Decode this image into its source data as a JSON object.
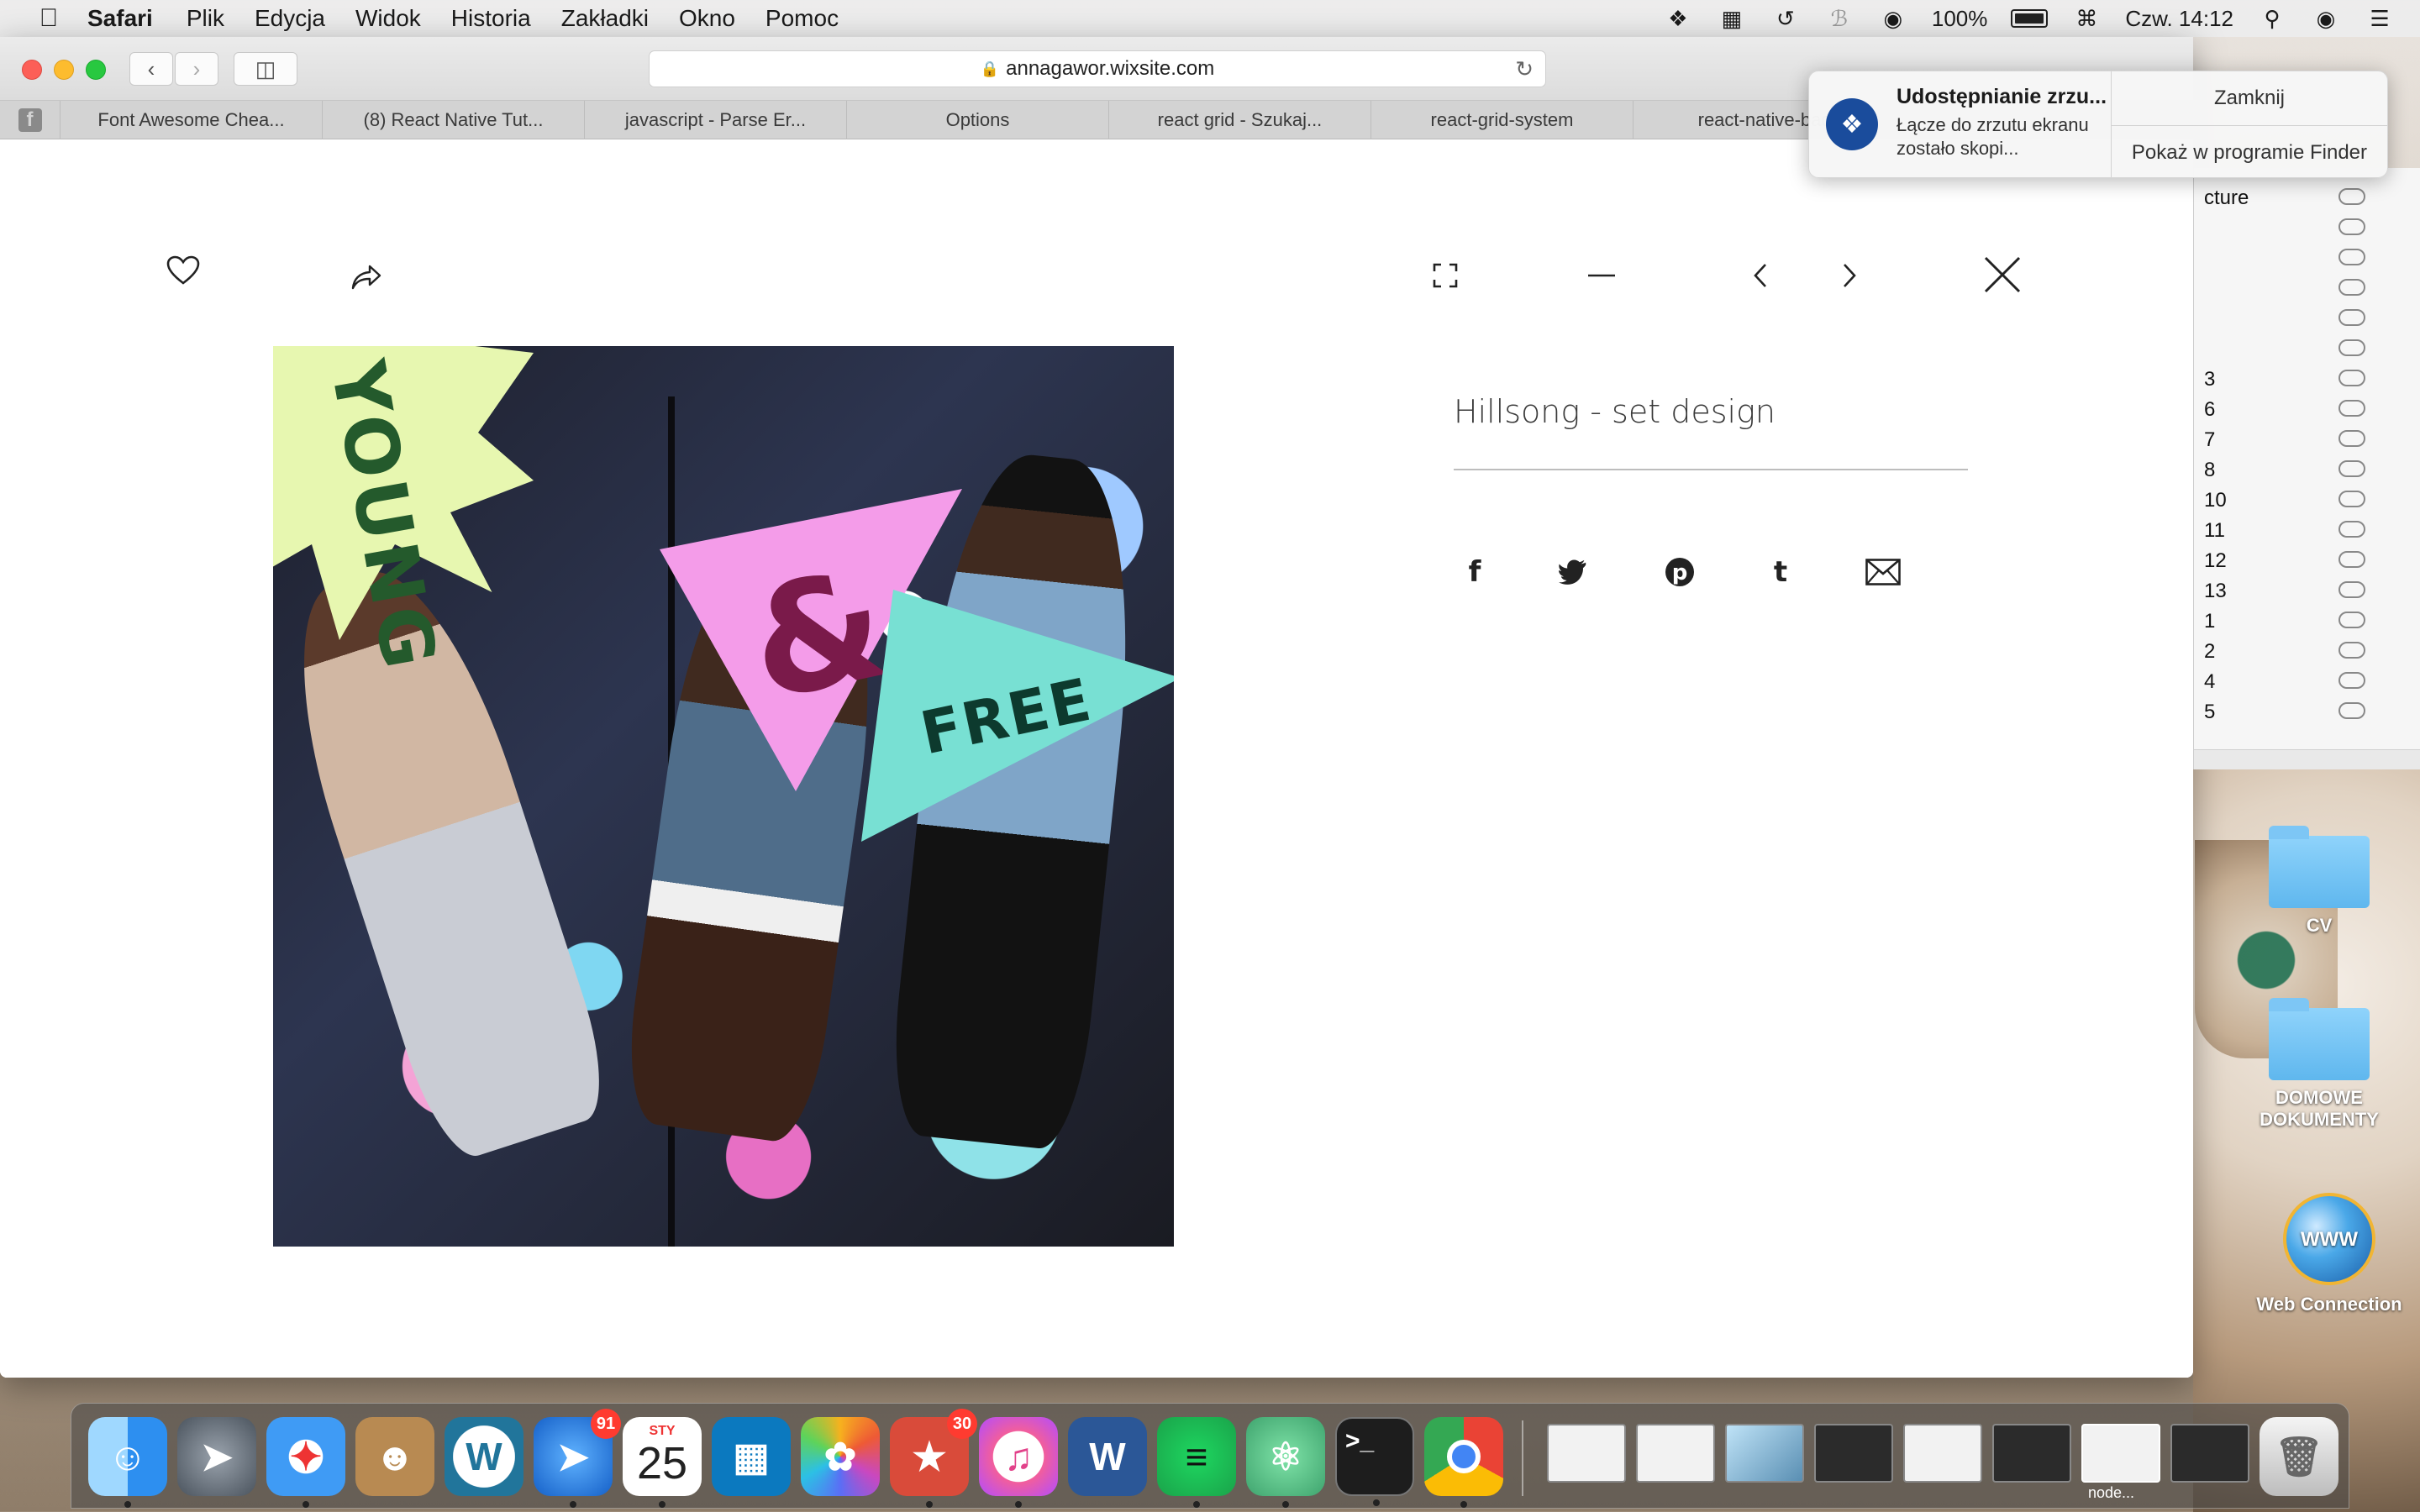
{
  "menubar": {
    "apple_icon": "apple-icon",
    "app_name": "Safari",
    "menus": [
      "Plik",
      "Edycja",
      "Widok",
      "Historia",
      "Zakładki",
      "Okno",
      "Pomoc"
    ],
    "battery": "100%",
    "clock": "Czw. 14:12",
    "status_icons": [
      "dropbox-icon",
      "evernote-icon",
      "time-machine-icon",
      "bluetooth-icon",
      "wifi-icon",
      "battery-icon",
      "keyboard-icon",
      "search-icon",
      "siri-icon",
      "notification-center-icon"
    ]
  },
  "browser": {
    "url": "annagawor.wixsite.com",
    "tabs": [
      "Font Awesome Chea...",
      "(8) React Native Tut...",
      "javascript - Parse Er...",
      "Options",
      "react grid - Szukaj...",
      "react-grid-system",
      "react-native-bac"
    ]
  },
  "lightbox": {
    "title": "Hillsong - set design",
    "photo_texts": {
      "young": "YOUNG",
      "amp": "&",
      "free": "FREE"
    },
    "top_icons": [
      "heart-icon",
      "share-arrow-icon",
      "fullscreen-icon",
      "minimize-icon",
      "prev-icon",
      "next-icon",
      "close-icon"
    ],
    "share_icons": [
      "facebook-icon",
      "twitter-icon",
      "pinterest-icon",
      "tumblr-icon",
      "email-icon"
    ],
    "share_glyphs": {
      "facebook": "f",
      "tumblr": "t"
    }
  },
  "notification": {
    "title": "Udostępnianie zrzu...",
    "text": "Łącze do zrzutu ekranu zostało skopi...",
    "close_label": "Zamknij",
    "finder_label": "Pokaż w programie Finder"
  },
  "finder": {
    "rows": [
      "cture",
      "",
      "",
      "",
      "",
      "",
      "3",
      "6",
      "7",
      "8",
      "10",
      "11",
      "12",
      "13",
      "1",
      "2",
      "4",
      "5"
    ]
  },
  "desktop": {
    "items": [
      "CV",
      "DOMOWE DOKUMENTY",
      "Web Connection"
    ]
  },
  "dock": {
    "apps": [
      "Finder",
      "Launchpad",
      "Safari",
      "Contacts",
      "WordPress",
      "Navigator",
      "Calendar",
      "Trello",
      "Photos",
      "Wunderlist",
      "iTunes",
      "Word",
      "Spotify",
      "Atom",
      "Terminal",
      "Chrome"
    ],
    "badges": {
      "navigator": "91",
      "wunderlist": "30"
    },
    "calendar_month": "STY",
    "calendar_day": "25",
    "window_label": "node..."
  }
}
